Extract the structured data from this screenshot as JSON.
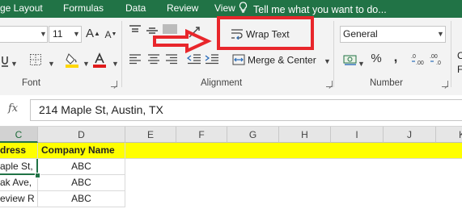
{
  "ribbon_tabs": [
    "ge Layout",
    "Formulas",
    "Data",
    "Review",
    "View"
  ],
  "tell_me": "Tell me what you want to do...",
  "font": {
    "size_value": "11",
    "grow_label": "A",
    "shrink_label": "A",
    "group_label": "Font"
  },
  "alignment": {
    "wrap_text_label": "Wrap Text",
    "merge_center_label": "Merge & Center",
    "group_label": "Alignment"
  },
  "number": {
    "format_value": "General",
    "percent_label": "%",
    "comma_label": ",",
    "group_label": "Number",
    "right_edge_label": "C",
    "right_edge_label_2": "Fo"
  },
  "formula_bar": {
    "fx_label": "fx",
    "value": "214 Maple St, Austin, TX"
  },
  "grid": {
    "columns": [
      "C",
      "D",
      "E",
      "F",
      "G",
      "H",
      "I",
      "J",
      "K"
    ],
    "header_row": [
      "dress",
      "Company Name"
    ],
    "rows": [
      [
        "aple St,",
        "ABC"
      ],
      [
        "ak Ave,",
        "ABC"
      ],
      [
        "eview R",
        "ABC"
      ]
    ]
  },
  "colors": {
    "ribbon_green": "#217346",
    "highlight_red": "#e8262b",
    "header_yellow": "#ffff00",
    "font_red": "#e01b1b",
    "fill_yellow": "#ffd700"
  },
  "icons": [
    "bold-icon",
    "underline-icon",
    "borders-icon",
    "fill-color-icon",
    "font-color-icon",
    "align-top-icon",
    "align-middle-icon",
    "align-bottom-icon",
    "orientation-icon",
    "align-left-icon",
    "align-center-icon",
    "align-right-icon",
    "decrease-indent-icon",
    "increase-indent-icon",
    "wrap-text-icon",
    "merge-center-icon",
    "accounting-icon",
    "increase-decimal-icon",
    "decrease-decimal-icon",
    "function-icon",
    "arrow-annotation-icon"
  ]
}
